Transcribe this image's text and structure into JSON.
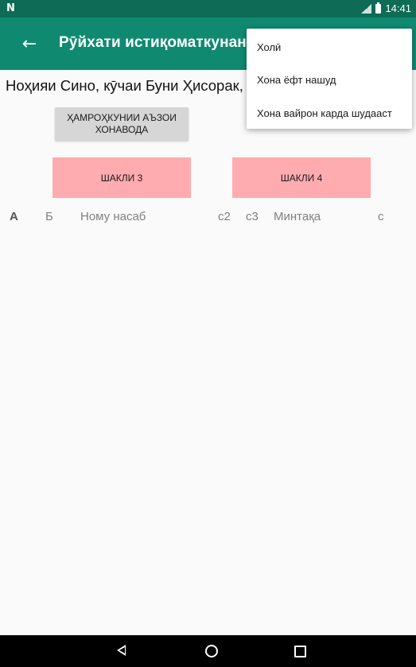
{
  "status_bar": {
    "left_icon": "N",
    "time": "14:41",
    "icons": [
      "signal-icon",
      "battery-icon"
    ]
  },
  "app_bar": {
    "back_icon": "←",
    "title": "Рӯйхати истиқоматкунандагон"
  },
  "content": {
    "address": "Ноҳияи Сино, кӯчаи Буни Ҳисорак, хонаи",
    "household_members_button": "Ҳамроҳкунии аъзои хонавода",
    "form3_button": "Шакли 3",
    "form4_button": "Шакли 4"
  },
  "table": {
    "columns": [
      "А",
      "Б",
      "Ному насаб",
      "с2",
      "с3",
      "Минтақа",
      "с"
    ]
  },
  "popup_menu": {
    "items": [
      "Холӣ",
      "Хона ёфт нашуд",
      "Хона вайрон карда шудааст"
    ]
  },
  "nav_bar": {
    "icons": [
      "back-triangle-icon",
      "home-circle-icon",
      "recent-square-icon"
    ]
  },
  "colors": {
    "status_bar": "#0d6b56",
    "app_bar": "#0f8a70",
    "pink_button": "#ffacb0",
    "grey_button": "#d6d6d6"
  }
}
